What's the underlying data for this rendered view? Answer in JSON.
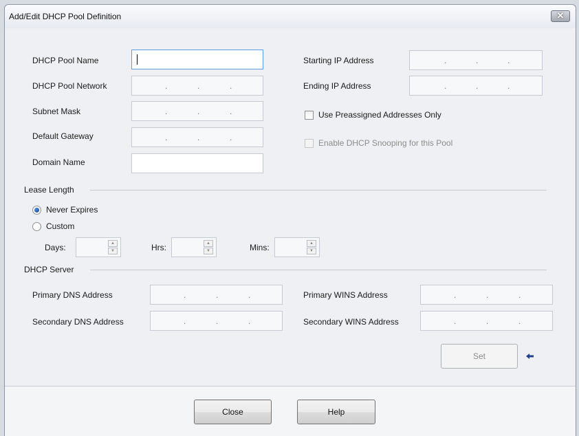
{
  "window": {
    "title": "Add/Edit DHCP Pool Definition",
    "close_glyph": "✕"
  },
  "pool": {
    "name_label": "DHCP Pool Name",
    "name_value": "",
    "network_label": "DHCP Pool Network",
    "subnet_label": "Subnet Mask",
    "gateway_label": "Default Gateway",
    "domain_label": "Domain Name",
    "domain_value": "",
    "start_ip_label": "Starting IP Address",
    "end_ip_label": "Ending IP Address",
    "preassigned_label": "Use Preassigned Addresses Only",
    "preassigned_checked": false,
    "snooping_label": "Enable DHCP Snooping for this Pool",
    "snooping_checked": false,
    "snooping_enabled": false
  },
  "ip_placeholder_dot": ".",
  "lease": {
    "group_label": "Lease Length",
    "never_label": "Never Expires",
    "custom_label": "Custom",
    "selected": "Never Expires",
    "days_label": "Days:",
    "hrs_label": "Hrs:",
    "mins_label": "Mins:",
    "spin_up": "▲",
    "spin_down": "▼"
  },
  "server": {
    "group_label": "DHCP Server",
    "primary_dns_label": "Primary DNS Address",
    "secondary_dns_label": "Secondary DNS Address",
    "primary_wins_label": "Primary WINS Address",
    "secondary_wins_label": "Secondary WINS Address"
  },
  "buttons": {
    "set": "Set",
    "close": "Close",
    "help": "Help"
  },
  "icons": {
    "set_pointer": "arrow-left-icon",
    "set_pointer_glyph": "🡐"
  },
  "colors": {
    "focus_border": "#5f9ce6",
    "radio_fill": "#1e4f9c",
    "pointer_arrow": "#1f3f8a"
  }
}
